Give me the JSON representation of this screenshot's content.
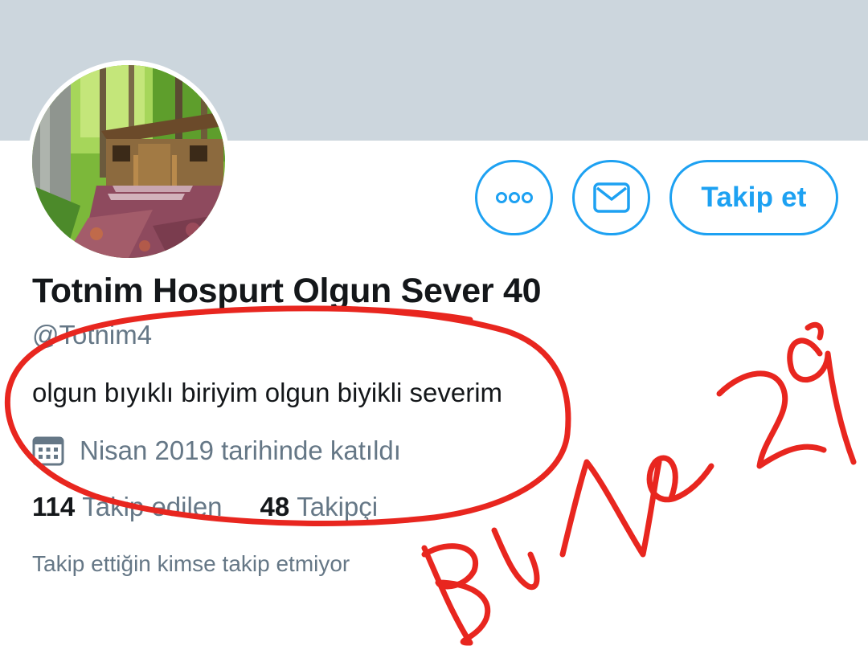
{
  "profile": {
    "display_name": "Totnim Hospurt Olgun Sever 40",
    "handle": "@Totnim4",
    "bio": "olgun bıyıklı biriyim olgun biyikli severim",
    "joined": "Nisan 2019 tarihinde katıldı",
    "following_count": "114",
    "following_label": "Takip edilen",
    "followers_count": "48",
    "followers_label": "Takipçi",
    "followers_you_know": "Takip ettiğin kimse takip etmiyor"
  },
  "actions": {
    "more_icon": "more-horizontal-icon",
    "message_icon": "envelope-icon",
    "follow_label": "Takip et"
  },
  "annotation": {
    "handwriting": "Bu ne 29",
    "color": "#e8261f"
  },
  "colors": {
    "accent": "#1da1f2",
    "banner": "#ccd6dd",
    "text_primary": "#14171a",
    "text_secondary": "#657786"
  }
}
